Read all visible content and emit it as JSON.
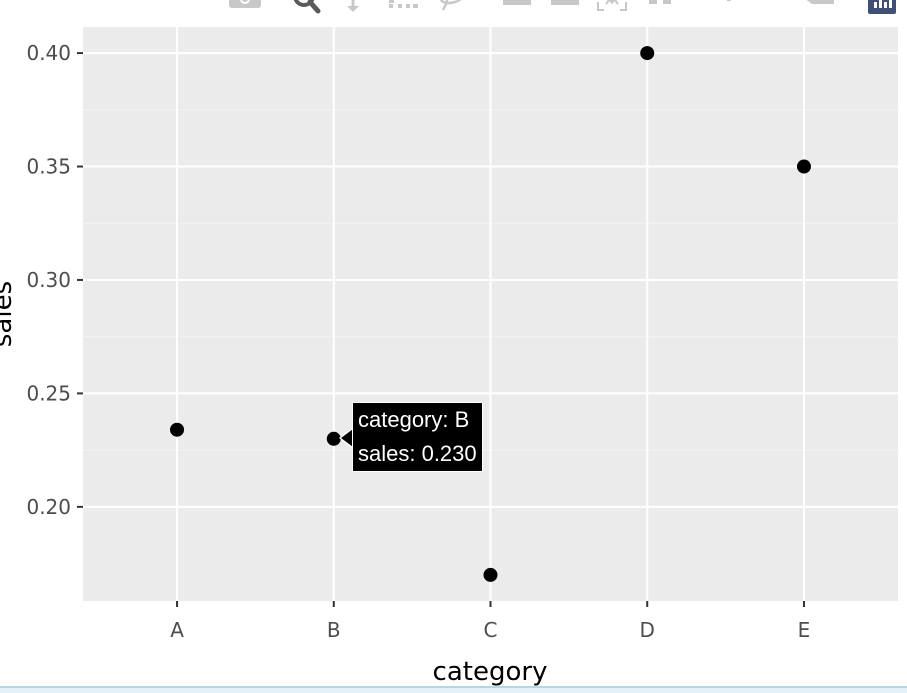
{
  "chart_data": {
    "type": "scatter",
    "title": "",
    "xlabel": "category",
    "ylabel": "sales",
    "categories": [
      "A",
      "B",
      "C",
      "D",
      "E"
    ],
    "values": [
      0.234,
      0.23,
      0.17,
      0.4,
      0.35
    ],
    "ylim": [
      0.1585,
      0.4115
    ],
    "yticks": [
      0.2,
      0.25,
      0.3,
      0.35,
      0.4
    ],
    "ytick_labels": [
      "0.20",
      "0.25",
      "0.30",
      "0.35",
      "0.40"
    ],
    "grid": true,
    "legend": "none",
    "marker_color": "#000000",
    "panel_background": "#ebebeb",
    "grid_color": "#ffffff"
  },
  "tooltip": {
    "category_line": "category: B",
    "sales_line": "sales: 0.230"
  },
  "modebar": {
    "buttons": [
      {
        "name": "download-png",
        "icon": "camera-icon"
      },
      {
        "name": "zoom",
        "icon": "zoom-icon",
        "active": true
      },
      {
        "name": "pan",
        "icon": "pan-icon"
      },
      {
        "name": "box-select",
        "icon": "box-select-icon"
      },
      {
        "name": "lasso-select",
        "icon": "lasso-icon"
      },
      {
        "name": "zoom-in",
        "icon": "zoom-in-icon"
      },
      {
        "name": "zoom-out",
        "icon": "zoom-out-icon"
      },
      {
        "name": "autoscale",
        "icon": "autoscale-icon"
      },
      {
        "name": "reset-axes",
        "icon": "home-icon"
      },
      {
        "name": "toggle-spike-lines",
        "icon": "spike-lines-icon"
      },
      {
        "name": "hover-closest",
        "icon": "hover-closest-icon",
        "active": true
      },
      {
        "name": "hover-compare",
        "icon": "hover-compare-icon"
      },
      {
        "name": "plotly-logo",
        "icon": "plotly-logo-icon"
      }
    ]
  }
}
